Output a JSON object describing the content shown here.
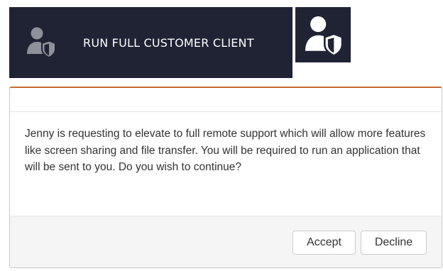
{
  "run_button": {
    "label": "RUN FULL CUSTOMER CLIENT",
    "icon": "user-shield-icon"
  },
  "icon_tile": {
    "icon": "user-shield-icon"
  },
  "dialog": {
    "message": "Jenny is requesting to elevate to full remote support which will allow more features like screen sharing and file transfer. You will be required to run an application that will be sent to you. Do you wish to continue?",
    "accept_label": "Accept",
    "decline_label": "Decline"
  },
  "colors": {
    "panel_background": "#1f2334",
    "icon_grey": "#8e9199",
    "icon_white": "#ffffff",
    "dialog_accent": "#c96b2c"
  }
}
